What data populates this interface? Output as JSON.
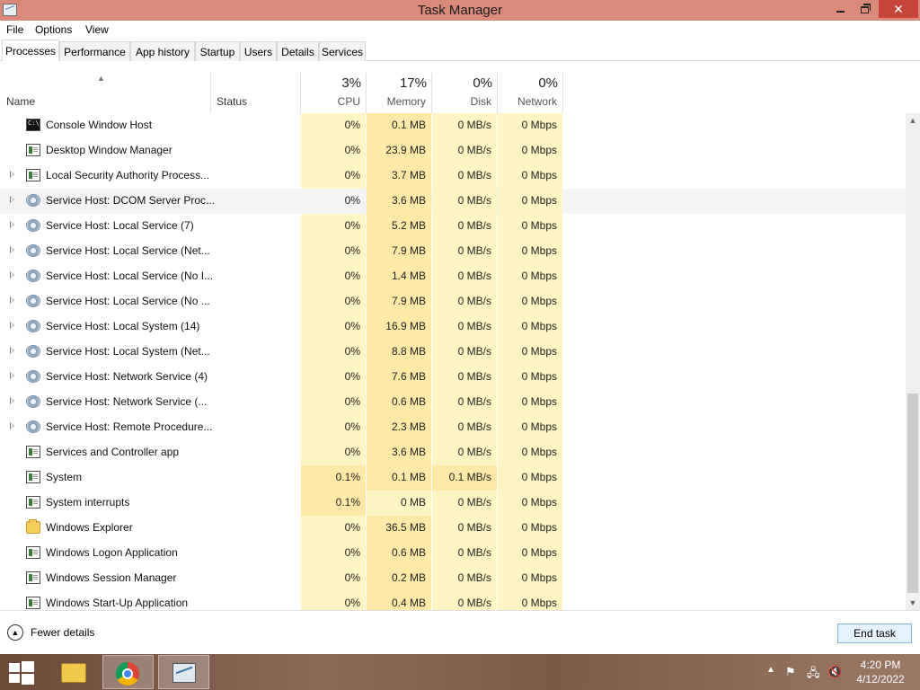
{
  "window": {
    "title": "Task Manager",
    "minimize_icon": "minimize-icon",
    "restore_icon": "restore-icon",
    "close_glyph": "✕"
  },
  "menu": [
    "File",
    "Options",
    "View"
  ],
  "tabs": [
    "Processes",
    "Performance",
    "App history",
    "Startup",
    "Users",
    "Details",
    "Services"
  ],
  "active_tab": "Processes",
  "columns": {
    "name": "Name",
    "status": "Status",
    "cpu": {
      "pct": "3%",
      "label": "CPU"
    },
    "memory": {
      "pct": "17%",
      "label": "Memory"
    },
    "disk": {
      "pct": "0%",
      "label": "Disk"
    },
    "network": {
      "pct": "0%",
      "label": "Network"
    }
  },
  "processes": [
    {
      "name": "Console Window Host",
      "icon": "console-icon",
      "expandable": false,
      "cpu": "0%",
      "memory": "0.1 MB",
      "disk": "0 MB/s",
      "network": "0 Mbps"
    },
    {
      "name": "Desktop Window Manager",
      "icon": "app-icon",
      "expandable": false,
      "cpu": "0%",
      "memory": "23.9 MB",
      "disk": "0 MB/s",
      "network": "0 Mbps"
    },
    {
      "name": "Local Security Authority Process...",
      "icon": "app-icon",
      "expandable": true,
      "cpu": "0%",
      "memory": "3.7 MB",
      "disk": "0 MB/s",
      "network": "0 Mbps"
    },
    {
      "name": "Service Host: DCOM Server Proc...",
      "icon": "gear-icon",
      "expandable": true,
      "cpu": "0%",
      "memory": "3.6 MB",
      "disk": "0 MB/s",
      "network": "0 Mbps",
      "hover": true
    },
    {
      "name": "Service Host: Local Service (7)",
      "icon": "gear-icon",
      "expandable": true,
      "cpu": "0%",
      "memory": "5.2 MB",
      "disk": "0 MB/s",
      "network": "0 Mbps"
    },
    {
      "name": "Service Host: Local Service (Net...",
      "icon": "gear-icon",
      "expandable": true,
      "cpu": "0%",
      "memory": "7.9 MB",
      "disk": "0 MB/s",
      "network": "0 Mbps"
    },
    {
      "name": "Service Host: Local Service (No I...",
      "icon": "gear-icon",
      "expandable": true,
      "cpu": "0%",
      "memory": "1.4 MB",
      "disk": "0 MB/s",
      "network": "0 Mbps"
    },
    {
      "name": "Service Host: Local Service (No ...",
      "icon": "gear-icon",
      "expandable": true,
      "cpu": "0%",
      "memory": "7.9 MB",
      "disk": "0 MB/s",
      "network": "0 Mbps"
    },
    {
      "name": "Service Host: Local System (14)",
      "icon": "gear-icon",
      "expandable": true,
      "cpu": "0%",
      "memory": "16.9 MB",
      "disk": "0 MB/s",
      "network": "0 Mbps"
    },
    {
      "name": "Service Host: Local System (Net...",
      "icon": "gear-icon",
      "expandable": true,
      "cpu": "0%",
      "memory": "8.8 MB",
      "disk": "0 MB/s",
      "network": "0 Mbps"
    },
    {
      "name": "Service Host: Network Service (4)",
      "icon": "gear-icon",
      "expandable": true,
      "cpu": "0%",
      "memory": "7.6 MB",
      "disk": "0 MB/s",
      "network": "0 Mbps"
    },
    {
      "name": "Service Host: Network Service (...",
      "icon": "gear-icon",
      "expandable": true,
      "cpu": "0%",
      "memory": "0.6 MB",
      "disk": "0 MB/s",
      "network": "0 Mbps"
    },
    {
      "name": "Service Host: Remote Procedure...",
      "icon": "gear-icon",
      "expandable": true,
      "cpu": "0%",
      "memory": "2.3 MB",
      "disk": "0 MB/s",
      "network": "0 Mbps"
    },
    {
      "name": "Services and Controller app",
      "icon": "app-icon",
      "expandable": false,
      "cpu": "0%",
      "memory": "3.6 MB",
      "disk": "0 MB/s",
      "network": "0 Mbps"
    },
    {
      "name": "System",
      "icon": "app-icon",
      "expandable": false,
      "cpu": "0.1%",
      "memory": "0.1 MB",
      "disk": "0.1 MB/s",
      "network": "0 Mbps"
    },
    {
      "name": "System interrupts",
      "icon": "app-icon",
      "expandable": false,
      "cpu": "0.1%",
      "memory": "0 MB",
      "disk": "0 MB/s",
      "network": "0 Mbps"
    },
    {
      "name": "Windows Explorer",
      "icon": "explorer-icon",
      "expandable": false,
      "cpu": "0%",
      "memory": "36.5 MB",
      "disk": "0 MB/s",
      "network": "0 Mbps"
    },
    {
      "name": "Windows Logon Application",
      "icon": "app-icon",
      "expandable": false,
      "cpu": "0%",
      "memory": "0.6 MB",
      "disk": "0 MB/s",
      "network": "0 Mbps"
    },
    {
      "name": "Windows Session Manager",
      "icon": "app-icon",
      "expandable": false,
      "cpu": "0%",
      "memory": "0.2 MB",
      "disk": "0 MB/s",
      "network": "0 Mbps"
    },
    {
      "name": "Windows Start-Up Application",
      "icon": "app-icon",
      "expandable": false,
      "cpu": "0%",
      "memory": "0.4 MB",
      "disk": "0 MB/s",
      "network": "0 Mbps"
    }
  ],
  "colors": {
    "heat_low": "#fff4c4",
    "heat_mid": "#ffe9a6",
    "title_bar": "#d98a7b",
    "close_button": "#c7443a"
  },
  "footer": {
    "fewer_details": "Fewer details",
    "end_task": "End task"
  },
  "taskbar": {
    "time": "4:20 PM",
    "date": "4/12/2022",
    "pinned": [
      "file-explorer-icon",
      "chrome-icon",
      "task-manager-icon"
    ]
  }
}
